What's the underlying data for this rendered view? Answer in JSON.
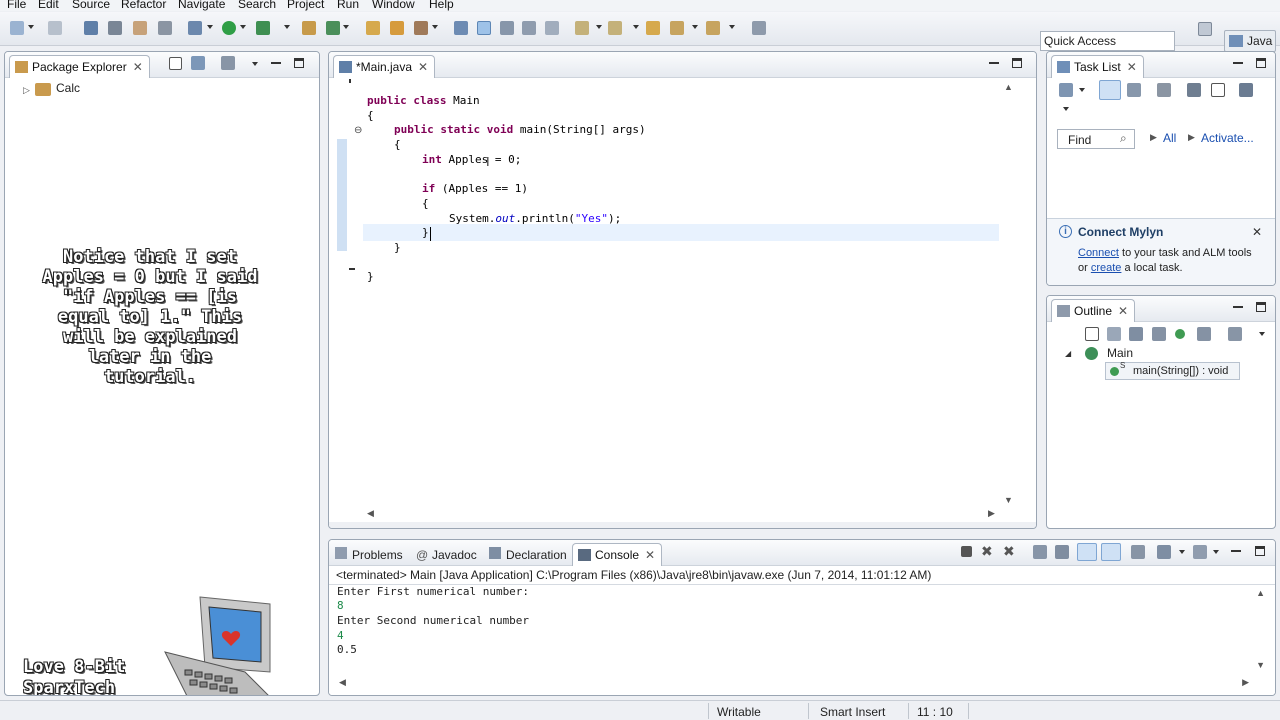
{
  "menu": [
    "File",
    "Edit",
    "Source",
    "Refactor",
    "Navigate",
    "Search",
    "Project",
    "Run",
    "Window",
    "Help"
  ],
  "toolbar": {
    "quick_access": "Quick Access",
    "perspective": "Java"
  },
  "package_explorer": {
    "title": "Package Explorer",
    "project": "Calc"
  },
  "overlay_note": "Notice that I set Apples = 0 but I said \"if Apples == [is equal to] 1.\" This will be explained later in the tutorial.",
  "overlay_note_lines": [
    "Notice that I set",
    "Apples = 0 but I said",
    "\"if Apples == [is",
    "equal to] 1.\" This",
    "will be explained",
    "later in the",
    "tutorial."
  ],
  "watermark": [
    "Love 8-Bit",
    "SparxTech"
  ],
  "editor": {
    "tab_title": "*Main.java",
    "code": {
      "l1_kw": "public class",
      "l1_rest": " Main",
      "l2": "{",
      "l3_kw": "public static void",
      "l3_rest": " main(String[] args)",
      "l4": "{",
      "l5_kw": "int",
      "l5_rest": " Apples = 0;",
      "l6_kw": "if",
      "l6_rest": " (Apples == 1)",
      "l7": "{",
      "l8_a": "System.",
      "l8_b": "out",
      "l8_c": ".println(",
      "l8_d": "\"Yes\"",
      "l8_e": ");",
      "l9": "}",
      "l10": "}",
      "l11": "}"
    }
  },
  "task_list": {
    "title": "Task List",
    "find_placeholder": "Find",
    "all": "All",
    "activate": "Activate...",
    "mylyn_title": "Connect Mylyn",
    "mylyn_link1": "Connect",
    "mylyn_text1": " to your task and ALM tools",
    "mylyn_text2": "or ",
    "mylyn_link2": "create",
    "mylyn_text3": " a local task."
  },
  "outline": {
    "title": "Outline",
    "class": "Main",
    "method": "main(String[]) : void"
  },
  "bottom_tabs": [
    "Problems",
    "Javadoc",
    "Declaration",
    "Console"
  ],
  "console": {
    "header": "<terminated> Main [Java Application] C:\\Program Files (x86)\\Java\\jre8\\bin\\javaw.exe (Jun 7, 2014, 11:01:12 AM)",
    "lines": [
      "Enter First numerical number:",
      "8",
      "Enter Second numerical number",
      "4",
      "0.5"
    ]
  },
  "status": {
    "writable": "Writable",
    "insert": "Smart Insert",
    "position": "11 : 10"
  },
  "colors": {
    "keyword": "#7f0055",
    "string": "#2a00ff",
    "field": "#0000c0",
    "accent": "#1a4fb0"
  }
}
